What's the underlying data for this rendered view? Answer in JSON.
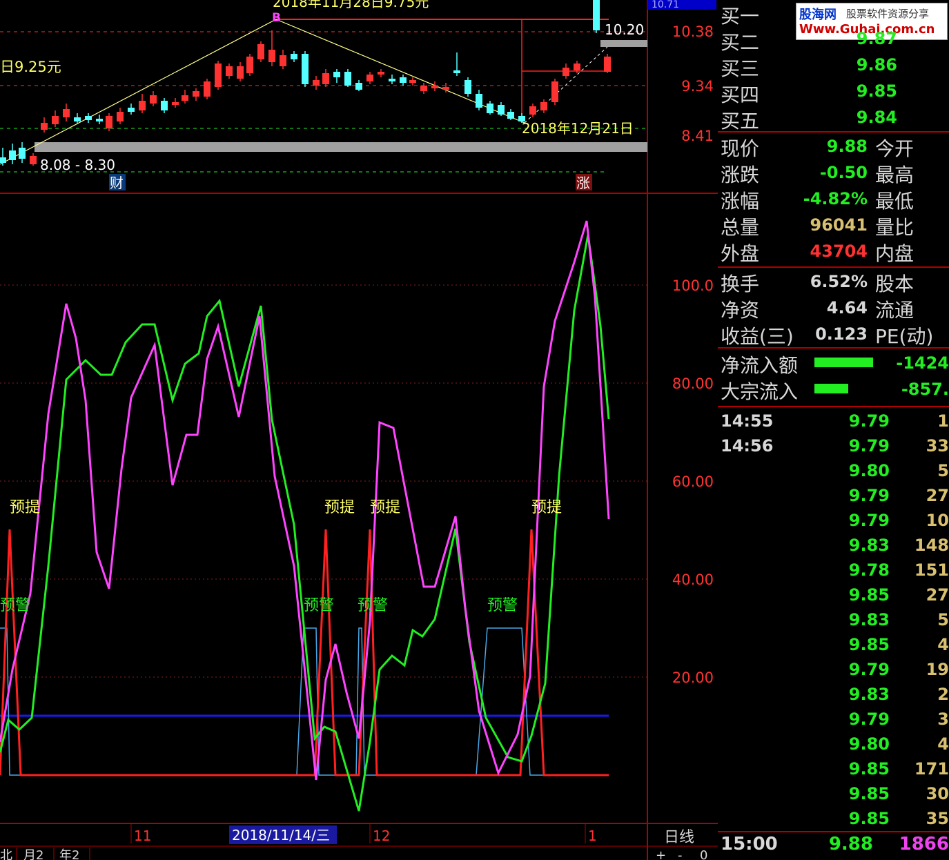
{
  "colors": {
    "up": "#ff3232",
    "down": "#54ffff",
    "green": "#22ee22",
    "magenta": "#ff44ff",
    "grid": "#b00000",
    "yellow": "#ffff66"
  },
  "main_chart": {
    "high_annotation": "2018年11月28日9.75元",
    "low_annotation": "2018年12月21日",
    "left_price_label": "日9.25元",
    "range_label": "8.08 - 8.30",
    "peak_marker": "B",
    "price_box_label": "10.20",
    "badge_fin": "财",
    "badge_up": "涨",
    "y_ticks": [
      "10.38",
      "9.34",
      "8.41"
    ],
    "top_right_value": "10.71"
  },
  "indicator": {
    "y_ticks": [
      "100.0",
      "80.00",
      "60.00",
      "40.00",
      "20.00"
    ],
    "signal_top": "预提",
    "signal_bottom": "预警"
  },
  "axis": {
    "month_11": "11",
    "cursor_date": "2018/11/14/三",
    "month_12": "12",
    "month_1": "1",
    "period": "日线",
    "bottom_tabs": [
      "北",
      "月2",
      "年2"
    ],
    "zoom": [
      "+",
      "-",
      "0"
    ]
  },
  "logo": {
    "cn": "股海网",
    "sub": "股票软件资源分享",
    "url": "Www.Guhai.com.cn"
  },
  "quote": {
    "bids": [
      {
        "label": "买一",
        "value": ""
      },
      {
        "label": "买二",
        "value": "9.87"
      },
      {
        "label": "买三",
        "value": "9.86"
      },
      {
        "label": "买四",
        "value": "9.85"
      },
      {
        "label": "买五",
        "value": "9.84"
      }
    ],
    "stats1": [
      {
        "label": "现价",
        "value": "9.88",
        "label2": "今开",
        "color": "#22ee22"
      },
      {
        "label": "涨跌",
        "value": "-0.50",
        "label2": "最高",
        "color": "#22ee22"
      },
      {
        "label": "涨幅",
        "value": "-4.82%",
        "label2": "最低",
        "color": "#22ee22"
      },
      {
        "label": "总量",
        "value": "96041",
        "label2": "量比",
        "color": "#d8c070"
      },
      {
        "label": "外盘",
        "value": "43704",
        "label2": "内盘",
        "color": "#ff3232"
      }
    ],
    "stats2": [
      {
        "label": "换手",
        "value": "6.52%",
        "label2": "股本",
        "color": "#d8d8d8"
      },
      {
        "label": "净资",
        "value": "4.64",
        "label2": "流通",
        "color": "#d8d8d8"
      },
      {
        "label": "收益(三)",
        "value": "0.123",
        "label2": "PE(动)",
        "color": "#d8d8d8"
      }
    ],
    "flows": [
      {
        "label": "净流入额",
        "value": "-1424",
        "bar": 0.65
      },
      {
        "label": "大宗流入",
        "value": "-857.",
        "bar": 0.38
      }
    ]
  },
  "ticks": [
    {
      "time": "14:55",
      "price": "9.79",
      "vol": "1",
      "volColor": "#d8c070"
    },
    {
      "time": "14:56",
      "price": "9.79",
      "vol": "33",
      "volColor": "#d8c070"
    },
    {
      "time": "",
      "price": "9.80",
      "vol": "5",
      "volColor": "#d8c070"
    },
    {
      "time": "",
      "price": "9.79",
      "vol": "27",
      "volColor": "#d8c070"
    },
    {
      "time": "",
      "price": "9.79",
      "vol": "10",
      "volColor": "#d8c070"
    },
    {
      "time": "",
      "price": "9.83",
      "vol": "148",
      "volColor": "#d8c070"
    },
    {
      "time": "",
      "price": "9.78",
      "vol": "151",
      "volColor": "#d8c070"
    },
    {
      "time": "",
      "price": "9.85",
      "vol": "27",
      "volColor": "#d8c070"
    },
    {
      "time": "",
      "price": "9.83",
      "vol": "5",
      "volColor": "#d8c070"
    },
    {
      "time": "",
      "price": "9.85",
      "vol": "4",
      "volColor": "#d8c070"
    },
    {
      "time": "",
      "price": "9.79",
      "vol": "19",
      "volColor": "#d8c070"
    },
    {
      "time": "",
      "price": "9.83",
      "vol": "2",
      "volColor": "#d8c070"
    },
    {
      "time": "",
      "price": "9.79",
      "vol": "3",
      "volColor": "#d8c070"
    },
    {
      "time": "",
      "price": "9.80",
      "vol": "4",
      "volColor": "#d8c070"
    },
    {
      "time": "",
      "price": "9.85",
      "vol": "171",
      "volColor": "#d8c070"
    },
    {
      "time": "",
      "price": "9.85",
      "vol": "30",
      "volColor": "#d8c070"
    },
    {
      "time": "",
      "price": "9.85",
      "vol": "35",
      "volColor": "#d8c070"
    }
  ],
  "last_tick": {
    "time": "15:00",
    "price": "9.88",
    "vol": "1866"
  }
}
